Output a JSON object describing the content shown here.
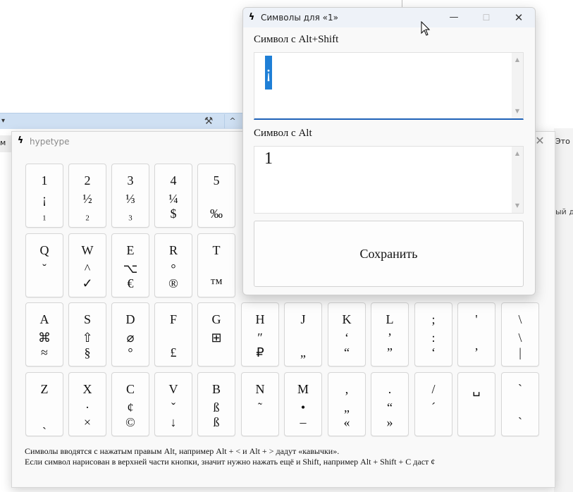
{
  "background": {
    "taskbar_arrow": "▾",
    "taskbar_tool_icon": "tools-icon",
    "taskbar_caret": "^",
    "left_tab_text": "м",
    "right_text_1": "Это",
    "right_text_2": "ый ди"
  },
  "main_window": {
    "title": "hypetype",
    "icon": "lightning-icon",
    "close_label": "✕",
    "rows": [
      [
        {
          "main": "1",
          "upper": "¡",
          "lower": "₁"
        },
        {
          "main": "2",
          "upper": "½",
          "lower": "₂"
        },
        {
          "main": "3",
          "upper": "⅓",
          "lower": "₃"
        },
        {
          "main": "4",
          "upper": "¼",
          "lower": "$"
        },
        {
          "main": "5",
          "upper": "",
          "lower": "‰"
        }
      ],
      [
        {
          "main": "Q",
          "upper": "˘",
          "lower": ""
        },
        {
          "main": "W",
          "upper": "^",
          "lower": "✓"
        },
        {
          "main": "E",
          "upper": "⌥",
          "lower": "€"
        },
        {
          "main": "R",
          "upper": "°",
          "lower": "®"
        },
        {
          "main": "T",
          "upper": "",
          "lower": "™"
        }
      ],
      [
        {
          "main": "A",
          "upper": "⌘",
          "lower": "≈"
        },
        {
          "main": "S",
          "upper": "⇧",
          "lower": "§"
        },
        {
          "main": "D",
          "upper": "⌀",
          "lower": "°"
        },
        {
          "main": "F",
          "upper": "",
          "lower": "£"
        },
        {
          "main": "G",
          "upper": "⊞",
          "lower": ""
        },
        {
          "main": "H",
          "upper": "″",
          "lower": "₽"
        },
        {
          "main": "J",
          "upper": "",
          "lower": "„"
        },
        {
          "main": "K",
          "upper": "‘",
          "lower": "“"
        },
        {
          "main": "L",
          "upper": "’",
          "lower": "”"
        },
        {
          "main": ";",
          "upper": ":",
          "lower": "‘"
        },
        {
          "main": "'",
          "upper": "",
          "lower": "’"
        },
        {
          "main": "\\",
          "upper": "\\",
          "lower": "|"
        }
      ],
      [
        {
          "main": "Z",
          "upper": "",
          "lower": "ˏ"
        },
        {
          "main": "X",
          "upper": "·",
          "lower": "×"
        },
        {
          "main": "C",
          "upper": "¢",
          "lower": "©"
        },
        {
          "main": "V",
          "upper": "ˇ",
          "lower": "↓"
        },
        {
          "main": "B",
          "upper": "ß",
          "lower": "ß"
        },
        {
          "main": "N",
          "upper": "˜",
          "lower": ""
        },
        {
          "main": "M",
          "upper": "•",
          "lower": "–"
        },
        {
          "main": ",",
          "upper": "„",
          "lower": "«"
        },
        {
          "main": ".",
          "upper": "“",
          "lower": "»"
        },
        {
          "main": "/",
          "upper": "´",
          "lower": ""
        },
        {
          "main": "␣",
          "upper": "",
          "lower": ""
        },
        {
          "main": "`",
          "upper": "",
          "lower": "`"
        }
      ]
    ],
    "hint_line1": "Символы вводятся с нажатым правым Alt, например Alt + < и Alt + > дадут «кавычки».",
    "hint_line2": "Если символ нарисован в верхней части кнопки, значит нужно нажать ещё и Shift, например Alt + Shift + C даст ¢"
  },
  "dialog": {
    "title": "Символы для «1»",
    "icon": "lightning-icon",
    "minimize_label": "—",
    "maximize_label": "☐",
    "close_label": "✕",
    "shift_label": "Символ с Alt+Shift",
    "shift_value": "¡",
    "alt_label": "Символ с Alt",
    "alt_value": "1",
    "save_label": "Сохранить"
  },
  "colors": {
    "accent": "#1f62b8",
    "selection": "#1f7fd6",
    "taskbar": "#cfe0f3"
  }
}
